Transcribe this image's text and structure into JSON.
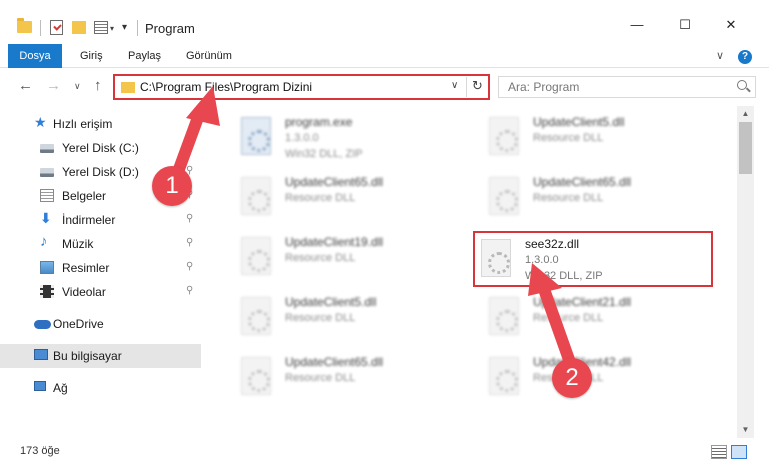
{
  "window": {
    "title": "Program",
    "minimize": "—",
    "maximize": "☐",
    "close": "✕"
  },
  "ribbon": {
    "tabs": [
      "Dosya",
      "Giriş",
      "Paylaş",
      "Görünüm"
    ],
    "expand": "∨",
    "help": "?"
  },
  "nav": {
    "back": "←",
    "forward": "→",
    "recent": "∨",
    "up": "↑",
    "address": "C:\\Program Files\\Program Dizini",
    "address_dropdown": "∨",
    "refresh": "↻",
    "search_placeholder": "Ara: Program"
  },
  "sidebar": {
    "items": [
      {
        "label": "Hızlı erişim",
        "icon": "star-icon"
      },
      {
        "label": "Yerel Disk (C:)",
        "icon": "drive-icon",
        "pin": "📌"
      },
      {
        "label": "Yerel Disk (D:)",
        "icon": "drive-icon",
        "pin": "📌"
      },
      {
        "label": "Belgeler",
        "icon": "documents-icon",
        "pin": "📌"
      },
      {
        "label": "İndirmeler",
        "icon": "download-icon",
        "pin": "📌"
      },
      {
        "label": "Müzik",
        "icon": "music-icon",
        "pin": "📌"
      },
      {
        "label": "Resimler",
        "icon": "pictures-icon",
        "pin": "📌"
      },
      {
        "label": "Videolar",
        "icon": "videos-icon",
        "pin": "📌"
      },
      {
        "label": "OneDrive",
        "icon": "onedrive-icon"
      },
      {
        "label": "Bu bilgisayar",
        "icon": "computer-icon"
      },
      {
        "label": "Ağ",
        "icon": "network-icon"
      }
    ]
  },
  "files": [
    {
      "name": "program.exe",
      "line2": "1.3.0.0",
      "line3": "Win32 DLL, ZIP"
    },
    {
      "name": "UpdateClient5.dll",
      "line2": "Resource DLL",
      "line3": ""
    },
    {
      "name": "UpdateClient65.dll",
      "line2": "Resource DLL",
      "line3": ""
    },
    {
      "name": "UpdateClient65.dll",
      "line2": "Resource DLL",
      "line3": ""
    },
    {
      "name": "UpdateClient19.dll",
      "line2": "Resource DLL",
      "line3": ""
    },
    {
      "name": "see32z.dll",
      "line2": "1.3.0.0",
      "line3": "Win32 DLL, ZIP"
    },
    {
      "name": "UpdateClient5.dll",
      "line2": "Resource DLL",
      "line3": ""
    },
    {
      "name": "UpdateClient21.dll",
      "line2": "Resource DLL",
      "line3": ""
    },
    {
      "name": "UpdateClient65.dll",
      "line2": "Resource DLL",
      "line3": ""
    },
    {
      "name": "UpdateClient42.dll",
      "line2": "Resource DLL",
      "line3": ""
    }
  ],
  "status": {
    "count": "173 öğe"
  },
  "annotations": {
    "step1": "1",
    "step2": "2",
    "color": "#e8474f"
  },
  "colors": {
    "accent": "#1979ca",
    "highlight_border": "#d8353b"
  }
}
